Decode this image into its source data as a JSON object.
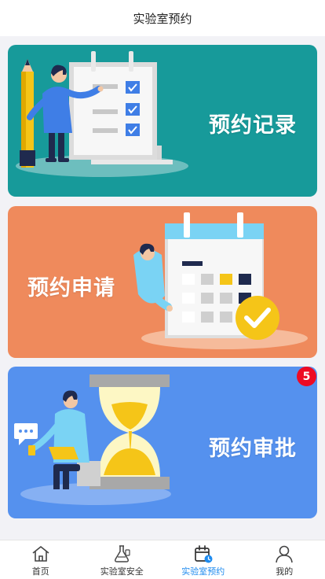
{
  "header": {
    "title": "实验室预约"
  },
  "cards": [
    {
      "label": "预约记录",
      "color": "#179a9a"
    },
    {
      "label": "预约申请",
      "color": "#ef8a5c"
    },
    {
      "label": "预约审批",
      "color": "#5591ee",
      "badge": "5"
    }
  ],
  "tabbar": {
    "active_color": "#1e8bef",
    "items": [
      {
        "label": "首页",
        "icon": "home-icon"
      },
      {
        "label": "实验室安全",
        "icon": "flask-icon"
      },
      {
        "label": "实验室预约",
        "icon": "calendar-icon",
        "active": true
      },
      {
        "label": "我的",
        "icon": "user-icon"
      }
    ]
  }
}
